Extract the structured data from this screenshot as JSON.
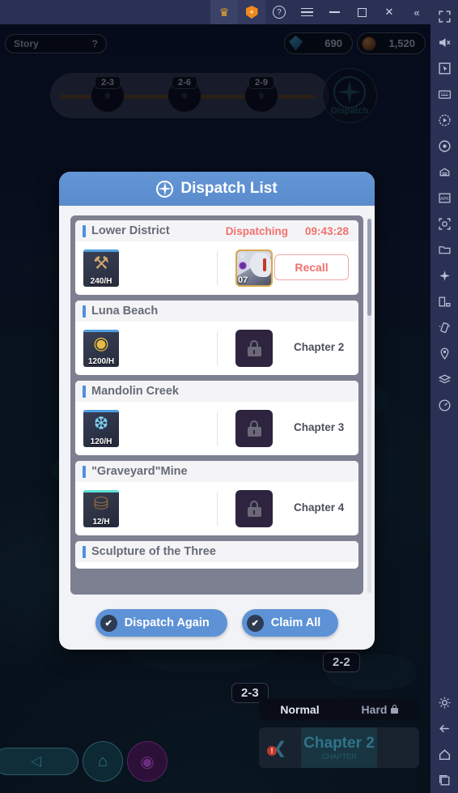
{
  "titlebar": {
    "buttons": [
      {
        "name": "premium-crown",
        "glyph": "♛"
      },
      {
        "name": "shield-boost",
        "glyph": "✹"
      },
      {
        "name": "help",
        "glyph": "?"
      },
      {
        "name": "menu",
        "glyph": ""
      },
      {
        "name": "minimize",
        "glyph": ""
      },
      {
        "name": "maximize",
        "glyph": ""
      },
      {
        "name": "close",
        "glyph": "✕"
      },
      {
        "name": "collapse",
        "glyph": "«"
      }
    ]
  },
  "hud": {
    "story_label": "Story",
    "story_help": "?",
    "gem_value": "690",
    "coin_value": "1,520"
  },
  "rail": {
    "nodes": [
      {
        "tag": "2-3",
        "icon": "stage-node-icon"
      },
      {
        "tag": "2-6",
        "icon": "stage-node-icon"
      },
      {
        "tag": "2-9",
        "icon": "stage-node-icon"
      }
    ],
    "dispatch_label": "Dispatch"
  },
  "dialog": {
    "title": "Dispatch List",
    "title_icon": "compass-icon",
    "rows": [
      {
        "name": "Lower District",
        "status": "Dispatching",
        "timer": "09:43:28",
        "reward_rate": "240/H",
        "reward_icon": "artifact-icon",
        "reward_accent": "#4f9fe0",
        "state": "active",
        "hero_level": "07",
        "action_label": "Recall"
      },
      {
        "name": "Luna Beach",
        "status": "",
        "timer": "",
        "reward_rate": "1200/H",
        "reward_icon": "gold-coin-icon",
        "reward_accent": "#4f9fe0",
        "state": "locked",
        "requirement": "Chapter 2"
      },
      {
        "name": "Mandolin Creek",
        "status": "",
        "timer": "",
        "reward_rate": "120/H",
        "reward_icon": "energy-icon",
        "reward_accent": "#4f9fe0",
        "state": "locked",
        "requirement": "Chapter 3"
      },
      {
        "name": "\"Graveyard\"Mine",
        "status": "",
        "timer": "",
        "reward_rate": "12/H",
        "reward_icon": "chest-icon",
        "reward_accent": "#5fe3d8",
        "state": "locked",
        "requirement": "Chapter 4"
      },
      {
        "name": "Sculpture of the Three",
        "status": "",
        "timer": "",
        "reward_rate": "",
        "reward_icon": "",
        "reward_accent": "#4f9fe0",
        "state": "partial",
        "requirement": ""
      }
    ],
    "footer": {
      "dispatch_again": "Dispatch Again",
      "claim_all": "Claim All",
      "check_glyph": "✔"
    }
  },
  "map": {
    "tag_current": "2-2",
    "tag_other": "2-3",
    "difficulty": {
      "normal": "Normal",
      "hard": "Hard"
    },
    "chapter_name": "Chapter 2",
    "chapter_sub": "CHAPTER"
  },
  "bottom_nav": {
    "back_glyph": "◁",
    "home_glyph": "⌂",
    "book_glyph": "◉"
  },
  "toolbar": {
    "items": [
      "fullscreen-icon",
      "mute-icon",
      "cursor-icon",
      "keyboard-icon",
      "record-icon",
      "rotate-icon",
      "multi-instance-icon",
      "apk-install-icon",
      "screenshot-icon",
      "folder-icon",
      "airplane-icon",
      "layout-icon",
      "shake-icon",
      "location-icon",
      "layers-icon",
      "meter-icon"
    ],
    "bottom_items": [
      "settings-icon",
      "back-icon",
      "home-icon",
      "recents-icon"
    ]
  }
}
